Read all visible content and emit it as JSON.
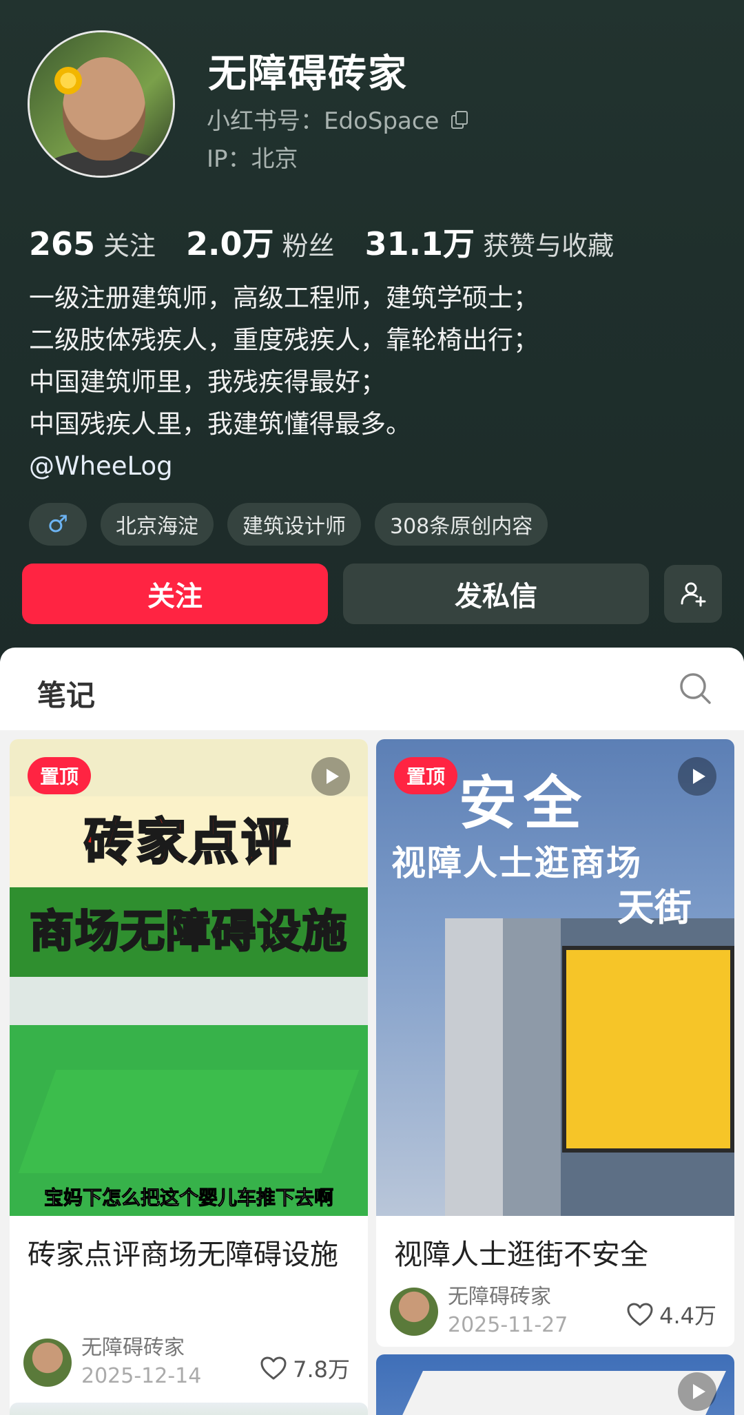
{
  "profile": {
    "nickname": "无障碍砖家",
    "account_label": "小红书号：EdoSpace",
    "ip_label": "IP：北京",
    "stats": [
      {
        "num": "265",
        "label": "关注"
      },
      {
        "num": "2.0万",
        "label": "粉丝"
      },
      {
        "num": "31.1万",
        "label": "获赞与收藏"
      }
    ],
    "bio": [
      "一级注册建筑师，高级工程师，建筑学硕士；",
      "二级肢体残疾人，重度残疾人，靠轮椅出行；",
      "中国建筑师里，我残疾得最好；",
      "中国残疾人里，我建筑懂得最多。"
    ],
    "mention": "@WheeLog",
    "tags": {
      "gender": "♂",
      "location": "北京海淀",
      "profession": "建筑设计师",
      "original_count": "308条原创内容"
    },
    "buttons": {
      "follow": "关注",
      "message": "发私信"
    }
  },
  "tabs": {
    "notes": "笔记"
  },
  "feed": [
    {
      "pin_label": "置顶",
      "cover_text_red": "砖家点评",
      "cover_text_yellow": "商场无障碍设施",
      "cover_caption": "宝妈下怎么把这个婴儿车推下去啊",
      "title": "砖家点评商场无障碍设施",
      "author": "无障碍砖家",
      "date": "2025-12-14",
      "likes": "7.8万"
    },
    {
      "pin_label": "置顶",
      "cover_text_big": "安全",
      "cover_text_sub": "视障人士逛商场",
      "cover_brand": "天街",
      "title": "视障人士逛街不安全",
      "author": "无障碍砖家",
      "date": "2025-11-27",
      "likes": "4.4万"
    }
  ],
  "colors": {
    "accent": "#ff2442",
    "header_bg": "#22332f"
  }
}
